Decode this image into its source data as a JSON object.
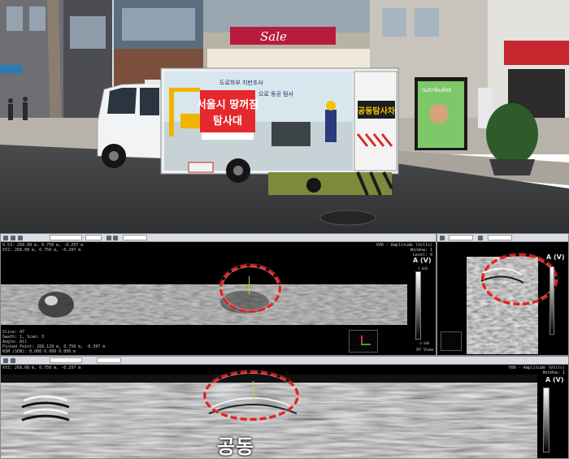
{
  "photo": {
    "truck_title_line1": "서울시 땅꺼짐",
    "truck_title_line2": "탐사대",
    "truck_banner_top": "도로하부 지반조사",
    "truck_banner_sub": "으로 동공 탐사",
    "truck_side_sign": "공동탐사차",
    "store_sign_sale": "Sale",
    "bus_ad_brand": "nutribullet"
  },
  "viewer": {
    "panel_top_left": {
      "info_lines": [
        "0.53: 268.08 m, 0.750 m, -0.297 m",
        "XYZ: 268.08 m, 0.750 m, -0.297 m"
      ],
      "bottom_lines": [
        "Slice: 47",
        "Swath: 1, Scan: 3",
        "Angle: All",
        "Picked Point: 268.129 m, 0.750 m, -0.397 m",
        "RSM (SEN): 0.000 0.000 0.000 m"
      ],
      "amp_header": "V00 - Amplitude (Volts)",
      "amp_sub": [
        "Window: 1",
        "Level: 0"
      ],
      "amp_label": "A (V)",
      "cb_top": "4.000",
      "cb_bottom": "-4.000",
      "view_label": "XY View"
    },
    "panel_top_right": {
      "amp_label": "A (V)"
    },
    "panel_bottom": {
      "info_line": "XYZ: 268.08 m, 0.750 m, -0.297 m",
      "amp_header": "V00 - Amplitude (Volts)",
      "amp_sub": "Window: 1",
      "amp_label": "A (V)"
    },
    "cavity_label": "공동"
  },
  "colors": {
    "annotation": "#e02020"
  }
}
